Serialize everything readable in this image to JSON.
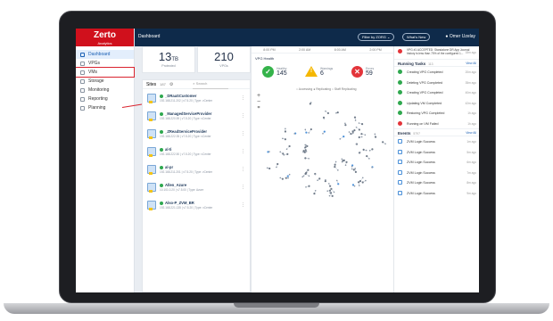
{
  "app": {
    "logo": "Zerto",
    "logo_sub": "Analytics",
    "page_title": "Dashboard"
  },
  "header": {
    "filter_label": "Filter by ZORG ⌄",
    "whats_new_label": "What's New",
    "user_name": "Omer Uzelay"
  },
  "sidebar": {
    "items": [
      {
        "label": "Dashboard",
        "icon": "grid-icon"
      },
      {
        "label": "VPGs",
        "icon": "shield-icon"
      },
      {
        "label": "VMs",
        "icon": "vm-icon"
      },
      {
        "label": "Storage",
        "icon": "storage-icon"
      },
      {
        "label": "Monitoring",
        "icon": "monitor-icon"
      },
      {
        "label": "Reporting",
        "icon": "report-icon"
      },
      {
        "label": "Planning",
        "icon": "planning-icon"
      }
    ]
  },
  "stats": [
    {
      "value": "13",
      "unit": "TB",
      "label": "Protected"
    },
    {
      "value": "210",
      "unit": "",
      "label": "VPGs"
    }
  ],
  "sites": {
    "title": "Sites",
    "count": "187",
    "search_placeholder": "Search",
    "items": [
      {
        "name": "_DRaaSCustomer",
        "meta": "192.168.211.202 | v7.5.20 | Type: vCenter"
      },
      {
        "name": "_ManagedServiceProvider",
        "meta": "192.168.220.59 | v7.5.20 | Type: vCenter"
      },
      {
        "name": "_ZReadServiceProvider",
        "meta": "192.168.222.35 | v7.5.20 | Type: vCenter"
      },
      {
        "name": "al-ti",
        "meta": "192.168.222.50 | v7.5.20 | Type: vCenter"
      },
      {
        "name": "al-pr",
        "meta": "192.168.211.201 | v7.5.20 | Type: vCenter"
      },
      {
        "name": "Allen_Azure",
        "meta": "10.101.0.20 | v7.5.00 | Type: Azure"
      },
      {
        "name": "Also-P_ZVM_BR",
        "meta": "192.168.221.135 | v7.5.20 | Type: vCenter"
      }
    ]
  },
  "vpg_map": {
    "time_labels": [
      "8:00 PM",
      "2:00 AM",
      "8:00 AM",
      "2:00 PM"
    ],
    "title": "VPG Health",
    "healthy_label": "Healthy",
    "healthy_value": "145",
    "warnings_label": "Warnings",
    "warnings_value": "6",
    "errors_label": "Errors",
    "errors_value": "59",
    "legend": "○ Accessing  ● Replicating  ○ Staff Replicating",
    "zoom_in": "+",
    "zoom_out": "−",
    "fit": "⌗"
  },
  "right_panel": {
    "alert_text": "VPG #1 ACCEPTED: Standalone DR App Journal history is less than 70% of the configured 1...",
    "alert_time": "18m ago",
    "running_tasks_title": "Running Tasks",
    "running_tasks_count": "113",
    "view_all": "View All",
    "tasks": [
      {
        "label": "Creating VPG Completed",
        "time": "20m ago",
        "color": "#2fa84f"
      },
      {
        "label": "Deleting VPG Completed",
        "time": "35m ago",
        "color": "#2fa84f"
      },
      {
        "label": "Creating VPG Completed",
        "time": "40m ago",
        "color": "#2fa84f"
      },
      {
        "label": "Updating VM Completed",
        "time": "42m ago",
        "color": "#2fa84f"
      },
      {
        "label": "Restoring VPG Completed",
        "time": "1h ago",
        "color": "#2fa84f"
      },
      {
        "label": "Running on VM Failed",
        "time": "1h ago",
        "color": "#e3343a"
      }
    ],
    "events_title": "Events",
    "events_count": "5797",
    "events": [
      {
        "label": "ZVM Login Success",
        "time": "1m ago"
      },
      {
        "label": "ZVM Login Success",
        "time": "5m ago"
      },
      {
        "label": "ZVM Login Success",
        "time": "6m ago"
      },
      {
        "label": "ZVM Login Success",
        "time": "7m ago"
      },
      {
        "label": "ZVM Login Success",
        "time": "8m ago"
      },
      {
        "label": "ZVM Login Success",
        "time": "9m ago"
      }
    ]
  }
}
